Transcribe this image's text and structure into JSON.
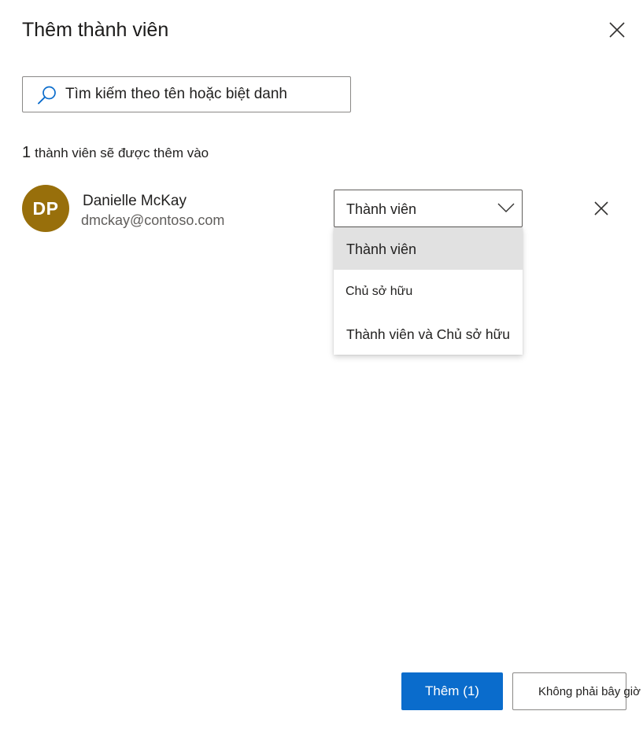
{
  "dialog": {
    "title": "Thêm thành viên"
  },
  "search": {
    "placeholder": "Tìm kiếm theo tên hoặc biệt danh",
    "value": ""
  },
  "members_summary": {
    "count": "1",
    "text": "thành viên sẽ được thêm vào"
  },
  "member": {
    "initials": "DP",
    "name": "Danielle McKay",
    "email": "dmckay@contoso.com",
    "avatar_color": "#986f0b"
  },
  "role_select": {
    "selected": "Thành viên",
    "options": [
      {
        "label": "Thành viên",
        "selected": true
      },
      {
        "label": "Chủ sở hữu",
        "selected": false
      },
      {
        "label": "Thành viên và Chủ sở hữu",
        "selected": false
      }
    ]
  },
  "footer": {
    "primary_label": "Thêm (1)",
    "secondary_label": "Không phải bây giờ"
  },
  "icons": {
    "close": "close-icon",
    "search": "search-icon",
    "chevron": "chevron-down-icon",
    "remove": "close-icon"
  },
  "colors": {
    "primary": "#0a6ccc",
    "selected_option": "#e1e1e1"
  }
}
